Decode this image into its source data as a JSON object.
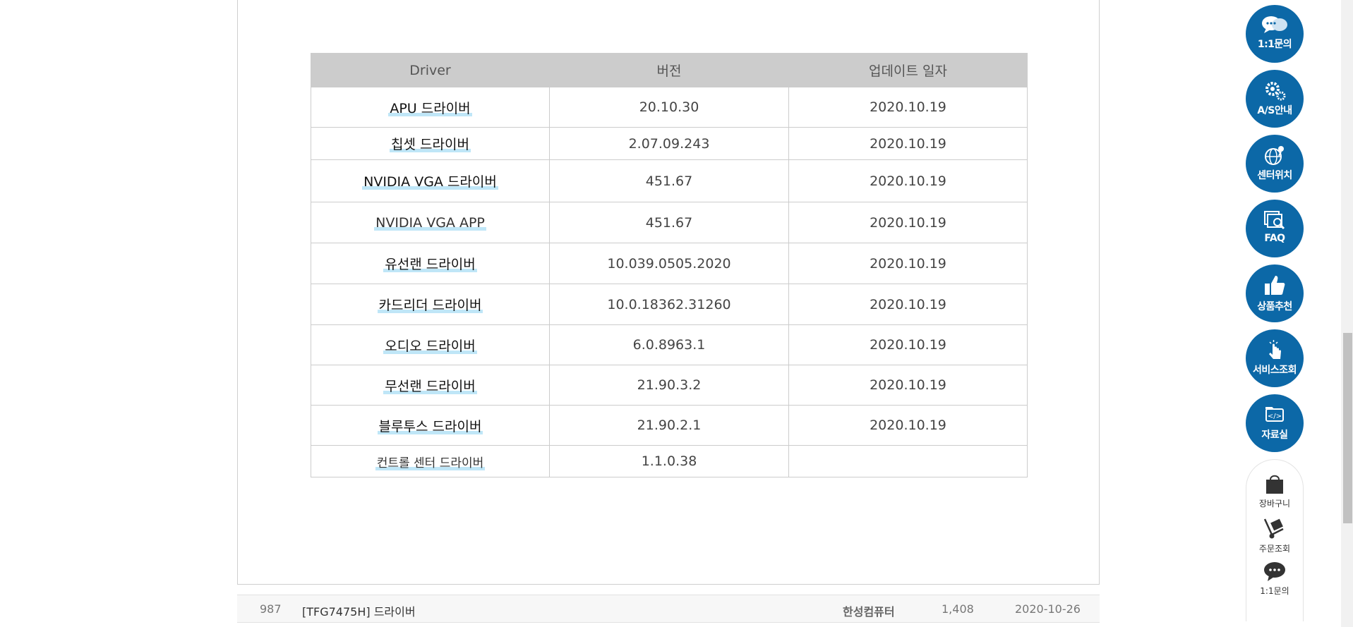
{
  "driver_table": {
    "headers": [
      "Driver",
      "버전",
      "업데이트 일자"
    ],
    "rows": [
      {
        "name": "APU 드라이버",
        "version": "20.10.30",
        "date": "2020.10.19"
      },
      {
        "name": "칩셋 드라이버",
        "version": "2.07.09.243",
        "date": "2020.10.19"
      },
      {
        "name": "NVIDIA VGA 드라이버",
        "version": "451.67",
        "date": "2020.10.19"
      },
      {
        "name": "NVIDIA VGA APP",
        "version": "451.67",
        "date": "2020.10.19"
      },
      {
        "name": "유선랜 드라이버",
        "version": "10.039.0505.2020",
        "date": "2020.10.19"
      },
      {
        "name": "카드리더 드라이버",
        "version": "10.0.18362.31260",
        "date": "2020.10.19"
      },
      {
        "name": "오디오 드라이버",
        "version": "6.0.8963.1",
        "date": "2020.10.19"
      },
      {
        "name": "무선랜 드라이버",
        "version": "21.90.3.2",
        "date": "2020.10.19"
      },
      {
        "name": "블루투스 드라이버",
        "version": "21.90.2.1",
        "date": "2020.10.19"
      },
      {
        "name": "컨트롤 센터 드라이버",
        "version": "1.1.0.38",
        "date": ""
      }
    ]
  },
  "list_row": {
    "number": "987",
    "title": "[TFG7475H] 드라이버",
    "author": "한성컴퓨터",
    "views": "1,408",
    "date": "2020-10-26"
  },
  "quick_menu": {
    "buttons": [
      {
        "label": "1:1문의",
        "icon": "chat-bubbles-icon"
      },
      {
        "label": "A/S안내",
        "icon": "gears-icon"
      },
      {
        "label": "센터위치",
        "icon": "globe-pin-icon"
      },
      {
        "label": "FAQ",
        "icon": "search-docs-icon"
      },
      {
        "label": "상품추천",
        "icon": "thumbs-up-icon"
      },
      {
        "label": "서비스조회",
        "icon": "pointer-hand-icon"
      },
      {
        "label": "자료실",
        "icon": "code-folder-icon"
      }
    ],
    "panel_items": [
      {
        "label": "장바구니",
        "icon": "shopping-bag-icon"
      },
      {
        "label": "주문조회",
        "icon": "hand-truck-icon"
      },
      {
        "label": "1:1문의",
        "icon": "speech-bubble-icon"
      }
    ],
    "button_color": "#0c68a7"
  },
  "colors": {
    "table_header_bg": "#cccccc",
    "name_highlight": "#bfe6f7"
  }
}
